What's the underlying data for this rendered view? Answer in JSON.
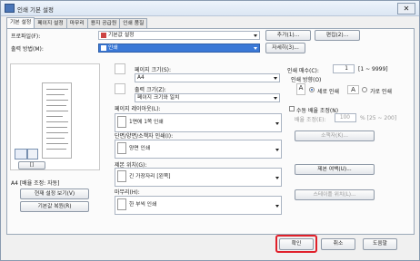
{
  "window": {
    "title": "인쇄 기본 설정",
    "close_glyph": "✕"
  },
  "tabs": [
    "기본 설정",
    "페이지 설정",
    "마무리",
    "용지 공급원",
    "인쇄 품질"
  ],
  "profile": {
    "label": "프로파일(F):",
    "value": "기본값 설정",
    "add_btn": "추가(1)...",
    "edit_btn": "편집(2)..."
  },
  "output": {
    "label": "출력 방법(M):",
    "value": "인쇄",
    "detail_btn": "자세히(3)..."
  },
  "page_size": {
    "label": "페이지 크기(S):",
    "value": "A4"
  },
  "output_size": {
    "label": "출력 크기(Z):",
    "value": "페이지 크기와 일치"
  },
  "copies": {
    "label": "인쇄 매수(C):",
    "value": "1",
    "range": "[1 ~ 9999]"
  },
  "orientation": {
    "label": "인쇄 방향(O)",
    "portrait": "세로 인쇄",
    "landscape": "가로 인쇄"
  },
  "layout": {
    "label": "페이지 레이아웃(L):",
    "value": "1면에 1쪽 인쇄"
  },
  "manual_scale": {
    "label": "수동 배율 조정(N)",
    "scale_label": "배율 조정(E):",
    "scale_value": "100",
    "scale_range": "% [25 ~ 200]"
  },
  "duplex": {
    "label": "단면/양면/소책자 인쇄(I):",
    "value": "양면 인쇄",
    "booklet_btn": "소책자(K)..."
  },
  "binding": {
    "label": "제본 위치(G):",
    "value": "긴 가장자리 [왼쪽]",
    "margin_btn": "제본 여백(U)..."
  },
  "finishing": {
    "label": "마무리(H):",
    "value": "한 부씩 인쇄",
    "staple_btn": "스테이플 위치(L)..."
  },
  "left_panel": {
    "status": "A4 [배율 조정: 자동]",
    "view_btn": "현재 설정 보기(V)",
    "restore_btn": "기본값 복원(R)",
    "toggle_label": "[]"
  },
  "footer": {
    "ok": "확인",
    "cancel": "취소",
    "help": "도움말"
  }
}
